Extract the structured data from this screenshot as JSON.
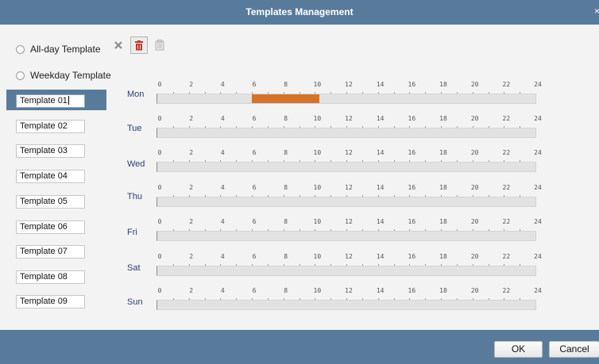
{
  "window": {
    "title": "Templates Management",
    "close_glyph": "×"
  },
  "options": [
    {
      "label": "All-day Template",
      "checked": false
    },
    {
      "label": "Weekday Template",
      "checked": false
    }
  ],
  "toolbar": {
    "icons": [
      "clear-icon",
      "delete-icon",
      "copy-icon"
    ],
    "accent_delete": "#c0392b"
  },
  "templates": [
    "Template 01",
    "Template 02",
    "Template 03",
    "Template 04",
    "Template 05",
    "Template 06",
    "Template 07",
    "Template 08",
    "Template 09"
  ],
  "selected_template": "Template 01",
  "schedule": {
    "tick_labels": [
      "0",
      "2",
      "4",
      "6",
      "8",
      "10",
      "12",
      "14",
      "16",
      "18",
      "20",
      "22",
      "24"
    ],
    "days": [
      {
        "label": "Mon",
        "segments": [
          {
            "start": 6,
            "end": 10.3
          }
        ]
      },
      {
        "label": "Tue",
        "segments": []
      },
      {
        "label": "Wed",
        "segments": []
      },
      {
        "label": "Thu",
        "segments": []
      },
      {
        "label": "Fri",
        "segments": []
      },
      {
        "label": "Sat",
        "segments": []
      },
      {
        "label": "Sun",
        "segments": []
      }
    ],
    "segment_color": "#d4742a"
  },
  "footer": {
    "ok_label": "OK",
    "cancel_label": "Cancel"
  },
  "colors": {
    "header": "#587b9c",
    "panel": "#f3f3f3",
    "day_label": "#2b3e78"
  }
}
